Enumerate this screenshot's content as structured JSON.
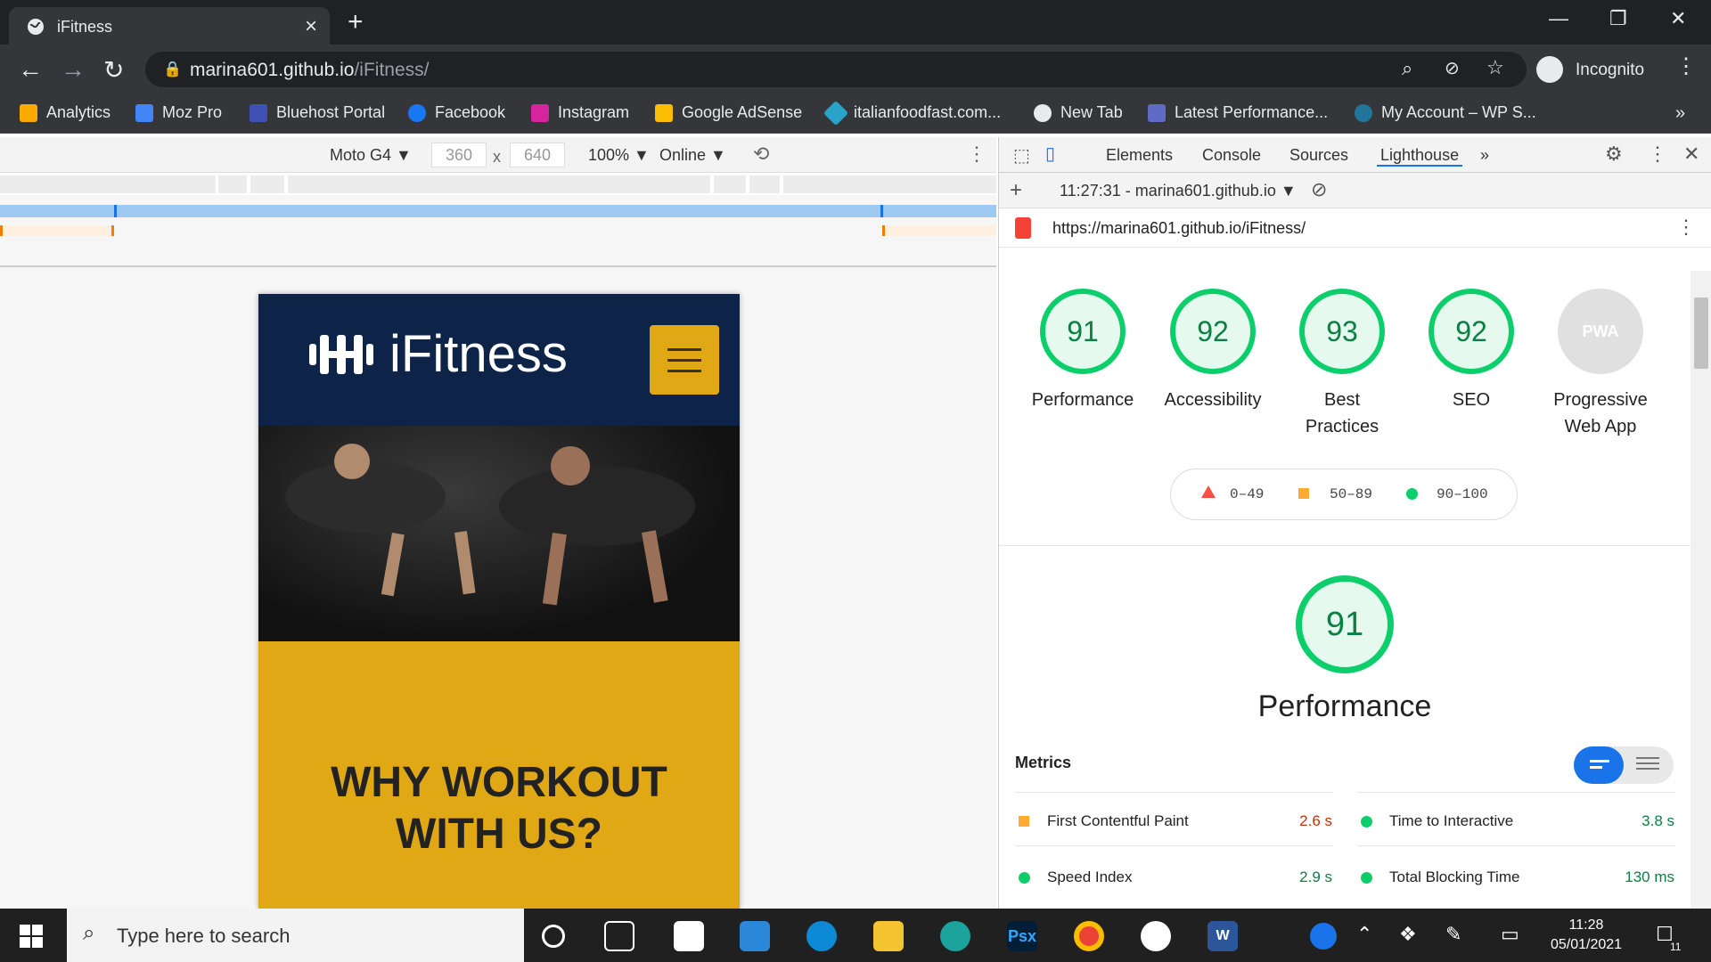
{
  "browser": {
    "tab_title": "iFitness",
    "url_host": "marina601.github.io",
    "url_path": "/iFitness/",
    "incognito_label": "Incognito"
  },
  "bookmarks": [
    {
      "label": "Analytics",
      "color": "#f9ab00"
    },
    {
      "label": "Moz Pro",
      "color": "#4285f4"
    },
    {
      "label": "Bluehost Portal",
      "color": "#3f51b5"
    },
    {
      "label": "Facebook",
      "color": "#1877f2"
    },
    {
      "label": "Instagram",
      "color": "#d6249f"
    },
    {
      "label": "Google AdSense",
      "color": "#fbbc04"
    },
    {
      "label": "italianfoodfast.com...",
      "color": "#2aa3c9"
    },
    {
      "label": "New Tab",
      "color": "#e8eaed"
    },
    {
      "label": "Latest Performance...",
      "color": "#5f6bc4"
    },
    {
      "label": "My Account – WP S...",
      "color": "#21759b"
    }
  ],
  "device_toolbar": {
    "device": "Moto G4 ▼",
    "width": "360",
    "height": "640",
    "times": "x",
    "zoom": "100% ▼",
    "network": "Online ▼"
  },
  "mobile_page": {
    "brand": "iFitness",
    "headline_line1": "WHY WORKOUT",
    "headline_line2": "WITH US?"
  },
  "devtools": {
    "tabs": [
      "Elements",
      "Console",
      "Sources",
      "Lighthouse"
    ],
    "active_tab": "Lighthouse",
    "report_selector": "11:27:31 - marina601.github.io ▼",
    "report_url": "https://marina601.github.io/iFitness/",
    "gauges": [
      {
        "score": "91",
        "label": "Performance"
      },
      {
        "score": "92",
        "label": "Accessibility"
      },
      {
        "score": "93",
        "label": "Best Practices"
      },
      {
        "score": "92",
        "label": "SEO"
      },
      {
        "score": "PWA",
        "label": "Progressive Web App"
      }
    ],
    "legend": [
      "0–49",
      "50–89",
      "90–100"
    ],
    "performance_score": "91",
    "performance_title": "Performance",
    "metrics_title": "Metrics",
    "metrics": [
      {
        "name": "First Contentful Paint",
        "value": "2.6 s",
        "status": "average"
      },
      {
        "name": "Time to Interactive",
        "value": "3.8 s",
        "status": "pass"
      },
      {
        "name": "Speed Index",
        "value": "2.9 s",
        "status": "pass"
      },
      {
        "name": "Total Blocking Time",
        "value": "130 ms",
        "status": "pass"
      }
    ]
  },
  "taskbar": {
    "search_placeholder": "Type here to search",
    "time": "11:28",
    "date": "05/01/2021",
    "notification_count": "11"
  },
  "colors": {
    "pass": "#0cce6b",
    "average": "#ffa400",
    "fail": "#ff4e42",
    "brand_navy": "#0d2448",
    "brand_yellow": "#e1a816"
  }
}
